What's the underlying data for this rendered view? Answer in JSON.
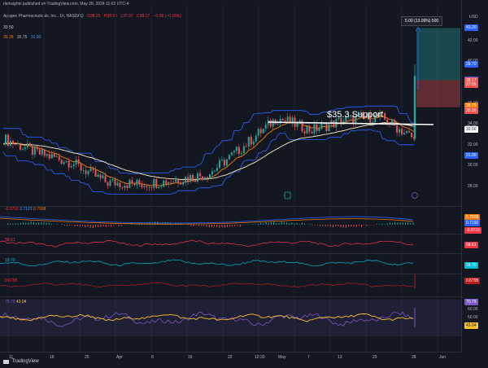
{
  "publisher": "rlainsights published on TradingView.com, May 28, 2024 11:02 UTC-4",
  "header": {
    "title": "Apogee Pharmaceuticals, Inc., 1h, NASDAQ",
    "ohlc": [
      "O38.25",
      "H38.56",
      "L37.97",
      "C38.17",
      "−0.06 (−0.16%)"
    ],
    "price_label": "33.50",
    "ema_values": [
      "35.28",
      "35.75",
      "31.00"
    ]
  },
  "currency": "USD",
  "measure": {
    "label": "5.00 (13.09%) 500"
  },
  "support": {
    "label": "$35.3 Support",
    "level": 35.3
  },
  "tv_logo": "TradingView",
  "icons": {
    "flag": "flag-icon",
    "lightning": "lightning-icon",
    "logo": "tradingview-logo-icon"
  },
  "colors": {
    "background": "#131722",
    "up": "#26a69a",
    "down": "#ef5350",
    "keltner": "#2962ff",
    "ema_orange": "#f57c00",
    "ema_white": "#fff3c4",
    "macd": "#f23645",
    "cci": "#00bcd4",
    "ad": "#b71c1c",
    "rsi": "#7e57c2",
    "rsi_ma": "#fbc02d"
  },
  "price_axis": {
    "ticks": [
      "43.00",
      "42.00",
      "40.00",
      "38.00",
      "36.00",
      "34.00",
      "32.00",
      "30.00",
      "28.00"
    ],
    "markers": [
      {
        "text": "43.20",
        "color": "#2962ff",
        "price": 43.2
      },
      {
        "text": "39.70",
        "color": "#2962ff",
        "price": 39.7
      },
      {
        "text": "38.20",
        "color": "#2962ff",
        "price": 38.2
      },
      {
        "text": "38.17",
        "color": "#ef5350",
        "price": 38.17
      },
      {
        "text": "27:05",
        "color": "#ef5350",
        "price": 37.75
      },
      {
        "text": "35.75",
        "color": "#f57c00",
        "price": 35.75
      },
      {
        "text": "35.30",
        "color": "#ef5350",
        "price": 35.3
      },
      {
        "text": "33.60",
        "color": "#2a2e39",
        "price": 33.6
      },
      {
        "text": "33.50",
        "color": "#ffffff",
        "price": 33.5
      },
      {
        "text": "31.00",
        "color": "#2962ff",
        "price": 31.0
      }
    ]
  },
  "date_axis": {
    "labels": [
      "11",
      "18",
      "25",
      "Apr",
      "8",
      "15",
      "22",
      "12:30",
      "May",
      "7",
      "13",
      "20",
      "28",
      "Jun"
    ]
  },
  "indicators": {
    "macd": {
      "label": "-0.0716",
      "values": [
        "0.7123",
        "0.7908"
      ],
      "axis": [
        "0.7908",
        "0.7192",
        "-0.0716"
      ]
    },
    "osc": {
      "label": "58.61",
      "axis": [
        "58.61"
      ]
    },
    "cci": {
      "label": "18.70",
      "axis": [
        "18.70"
      ]
    },
    "ad": {
      "label": "0.6795",
      "axis": [
        "0.6795"
      ]
    },
    "rsi": {
      "label": "70.79",
      "values": [
        "43.04"
      ],
      "axis": [
        "70.79",
        "60.00",
        "50.00",
        "43.04"
      ]
    }
  },
  "chart_data": {
    "type": "candlestick",
    "title": "Apogee Pharmaceuticals, Inc., 1h, NASDAQ",
    "x": [
      "11",
      "18",
      "25",
      "Apr",
      "8",
      "15",
      "22",
      "12:30",
      "May",
      "7",
      "13",
      "20",
      "28"
    ],
    "close": [
      32.6,
      31.2,
      30.3,
      28.4,
      28.2,
      28.6,
      29.2,
      31.8,
      34.6,
      33.4,
      34.4,
      34.7,
      32.6,
      38.17
    ],
    "ylim": [
      27.0,
      44.0
    ],
    "support_level": 35.3,
    "measurement": {
      "from": 38.2,
      "to": 43.2,
      "text": "5.00 (13.09%) 500"
    }
  }
}
